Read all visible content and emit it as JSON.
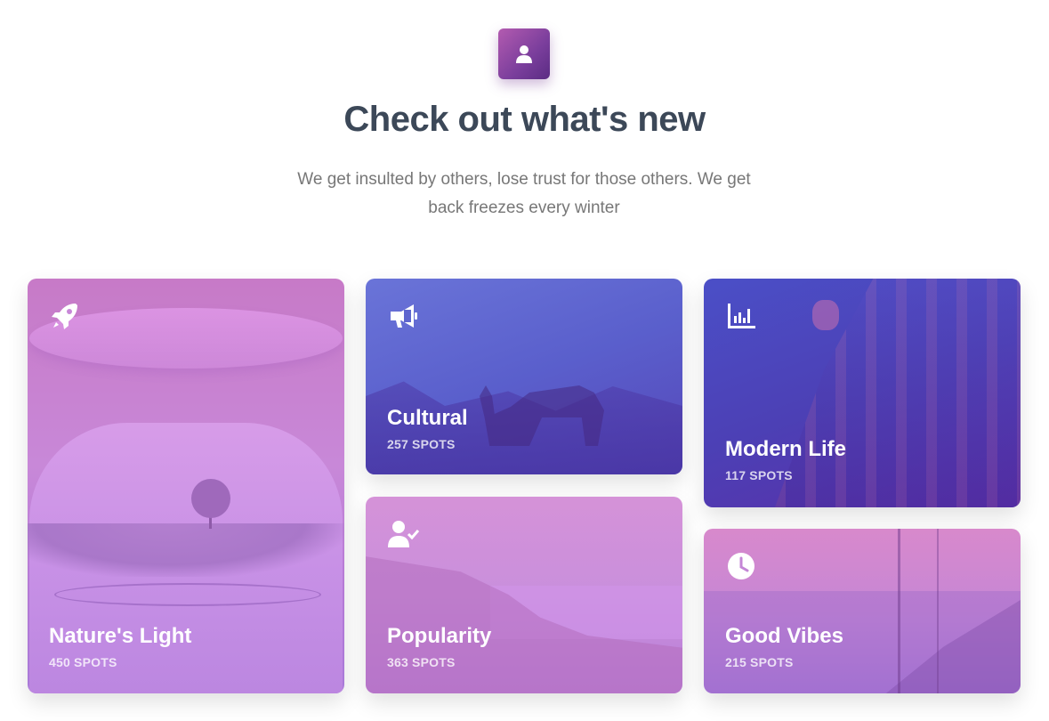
{
  "header": {
    "icon": "user-icon",
    "title": "Check out what's new",
    "subtitle": "We get insulted by others, lose trust for those others. We get back freezes every winter",
    "accent_gradient": [
      "#b35bb0",
      "#5b2c83"
    ]
  },
  "cards": [
    {
      "title": "Nature's Light",
      "count": "450 SPOTS",
      "icon": "rocket-icon",
      "tint": "#c888d8"
    },
    {
      "title": "Cultural",
      "count": "257 SPOTS",
      "icon": "megaphone-icon",
      "tint": "#5a5fcc"
    },
    {
      "title": "Modern Life",
      "count": "117 SPOTS",
      "icon": "bar-chart-icon",
      "tint": "#4c40b5"
    },
    {
      "title": "Popularity",
      "count": "363 SPOTS",
      "icon": "user-check-icon",
      "tint": "#c98fdc"
    },
    {
      "title": "Good Vibes",
      "count": "215 SPOTS",
      "icon": "clock-icon",
      "tint": "#c486d6"
    }
  ]
}
